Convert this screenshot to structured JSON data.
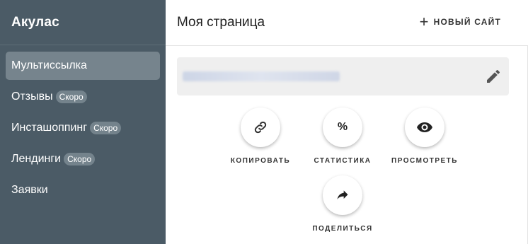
{
  "sidebar": {
    "brand": "Акулас",
    "items": [
      {
        "label": "Мультиссылка",
        "badge": ""
      },
      {
        "label": "Отзывы",
        "badge": "Скоро"
      },
      {
        "label": "Инсташоппинг",
        "badge": "Скоро"
      },
      {
        "label": "Лендинги",
        "badge": "Скоро"
      },
      {
        "label": "Заявки",
        "badge": ""
      }
    ]
  },
  "header": {
    "title": "Моя страница",
    "new_site_label": "НОВЫЙ САЙТ"
  },
  "actions": {
    "copy": "КОПИРОВАТЬ",
    "stats": "СТАТИСТИКА",
    "stats_symbol": "%",
    "view": "ПРОСМОТРЕТЬ",
    "share": "ПОДЕЛИТЬСЯ"
  },
  "icons": [
    "plus-icon",
    "edit-icon",
    "link-icon",
    "percent-icon",
    "eye-icon",
    "share-icon"
  ],
  "colors": {
    "sidebar_bg": "#4b5b66",
    "active_item": "#76848d",
    "badge_bg": "#74838c",
    "url_bar_bg": "#efefef"
  }
}
